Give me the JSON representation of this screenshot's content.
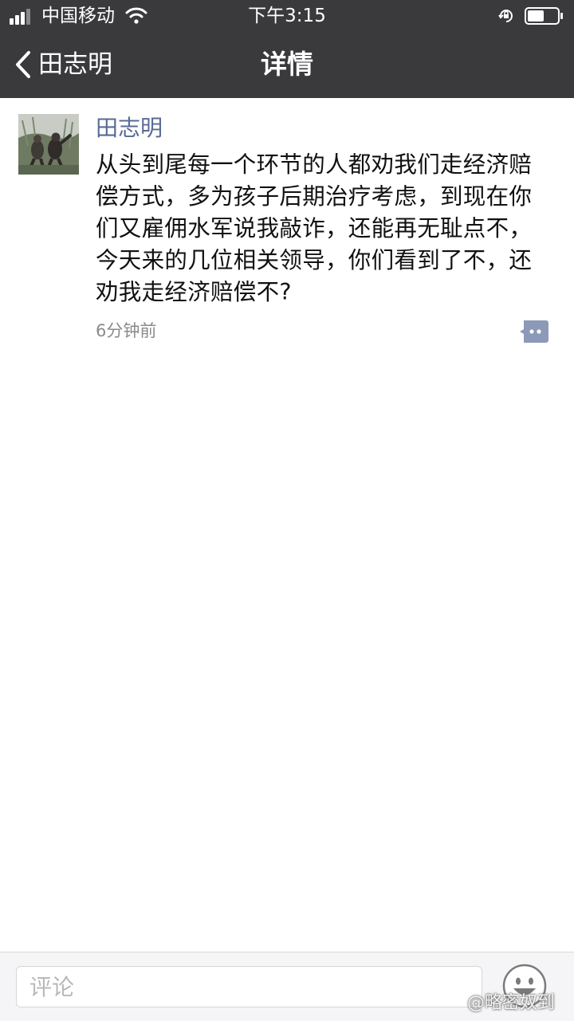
{
  "status_bar": {
    "carrier": "中国移动",
    "time": "下午3:15",
    "icons": [
      "signal-icon",
      "wifi-icon",
      "rotation-lock-icon",
      "battery-icon"
    ]
  },
  "nav": {
    "back_label": "田志明",
    "title": "详情"
  },
  "post": {
    "author": "田志明",
    "text": "从头到尾每一个环节的人都劝我们走经济赔偿方式，多为孩子后期治疗考虑，到现在你们又雇佣水军说我敲诈，还能再无耻点不，今天来的几位相关领导，你们看到了不，还劝我走经济赔偿不?",
    "time": "6分钟前"
  },
  "comment_bar": {
    "placeholder": "评论"
  },
  "watermark": "@略密奴到",
  "colors": {
    "header_bg": "#3a3a3d",
    "author_link": "#576b95",
    "comment_icon": "#8c99b8"
  }
}
